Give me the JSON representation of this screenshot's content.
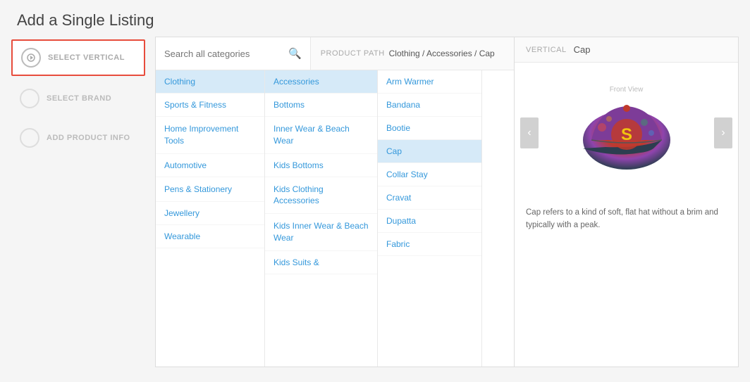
{
  "page": {
    "title": "Add a Single Listing"
  },
  "steps": [
    {
      "id": "select-vertical",
      "label": "SELECT VERTICAL",
      "active": true,
      "highlighted": true
    },
    {
      "id": "select-brand",
      "label": "SELECT BRAND",
      "active": false,
      "highlighted": false
    },
    {
      "id": "add-product-info",
      "label": "ADD PRODUCT INFO",
      "active": false,
      "highlighted": false
    }
  ],
  "search": {
    "placeholder": "Search all categories"
  },
  "product_path": {
    "label": "Product Path",
    "value": "Clothing / Accessories / Cap"
  },
  "columns": [
    {
      "id": "col1",
      "items": [
        {
          "label": "Clothing",
          "selected": true
        },
        {
          "label": "Sports & Fitness",
          "selected": false
        },
        {
          "label": "Home Improvement Tools",
          "selected": false
        },
        {
          "label": "Automotive",
          "selected": false
        },
        {
          "label": "Pens & Stationery",
          "selected": false
        },
        {
          "label": "Jewellery",
          "selected": false
        },
        {
          "label": "Wearable",
          "selected": false
        }
      ]
    },
    {
      "id": "col2",
      "items": [
        {
          "label": "Accessories",
          "selected": true
        },
        {
          "label": "Bottoms",
          "selected": false
        },
        {
          "label": "Inner Wear & Beach Wear",
          "selected": false
        },
        {
          "label": "Kids Bottoms",
          "selected": false
        },
        {
          "label": "Kids Clothing Accessories",
          "selected": false
        },
        {
          "label": "Kids Inner Wear & Beach Wear",
          "selected": false
        },
        {
          "label": "Kids Suits &",
          "selected": false
        }
      ]
    },
    {
      "id": "col3",
      "items": [
        {
          "label": "Arm Warmer",
          "selected": false
        },
        {
          "label": "Bandana",
          "selected": false
        },
        {
          "label": "Bootie",
          "selected": false
        },
        {
          "label": "Cap",
          "selected": true
        },
        {
          "label": "Collar Stay",
          "selected": false
        },
        {
          "label": "Cravat",
          "selected": false
        },
        {
          "label": "Dupatta",
          "selected": false
        },
        {
          "label": "Fabric",
          "selected": false
        }
      ]
    }
  ],
  "preview": {
    "vertical_label": "VERTICAL",
    "vertical_value": "Cap",
    "front_view_label": "Front View",
    "description": "Cap refers to a kind of soft, flat hat without a brim and typically with a peak."
  }
}
